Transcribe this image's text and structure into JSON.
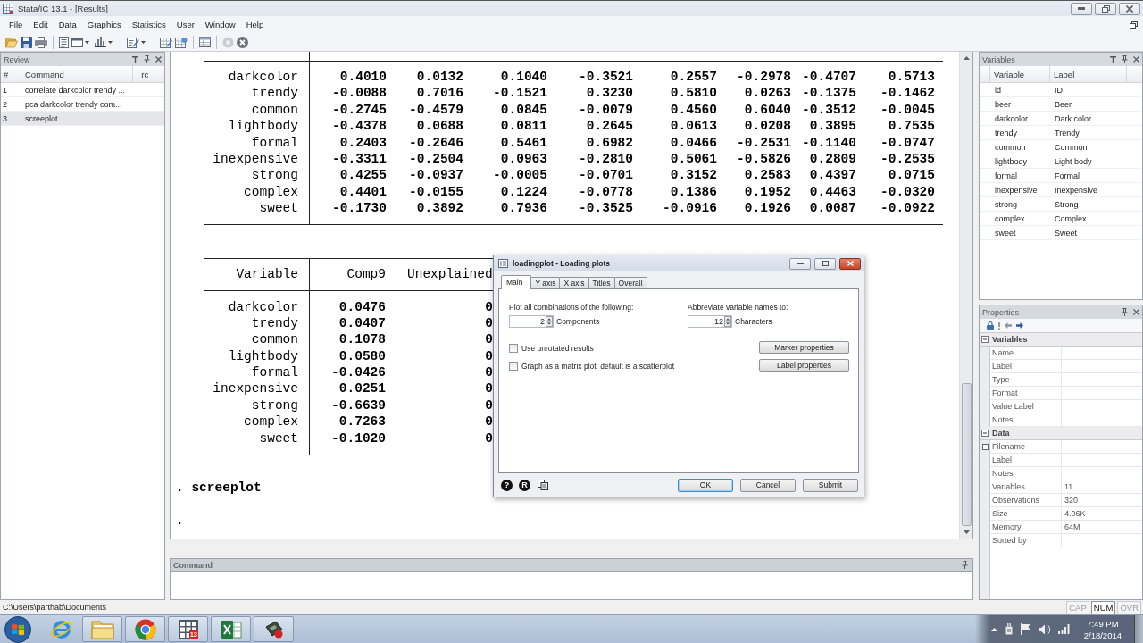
{
  "window": {
    "title": "Stata/IC 13.1 - [Results]"
  },
  "menu": [
    "File",
    "Edit",
    "Data",
    "Graphics",
    "Statistics",
    "User",
    "Window",
    "Help"
  ],
  "review": {
    "title": "Review",
    "columns": [
      "#",
      "Command",
      "_rc"
    ],
    "rows": [
      {
        "number": "1",
        "command": "correlate darkcolor trendy ...",
        "selected": false
      },
      {
        "number": "2",
        "command": "pca darkcolor trendy com...",
        "selected": false
      },
      {
        "number": "3",
        "command": "screeplot",
        "selected": true
      }
    ]
  },
  "results": {
    "loadings_table": {
      "rows": [
        {
          "variable": "darkcolor",
          "values": [
            "0.4010",
            "0.0132",
            "0.1040",
            "-0.3521",
            "0.2557",
            "-0.2978",
            "-0.4707",
            "0.5713"
          ]
        },
        {
          "variable": "trendy",
          "values": [
            "-0.0088",
            "0.7016",
            "-0.1521",
            "0.3230",
            "0.5810",
            "0.0263",
            "-0.1375",
            "-0.1462"
          ]
        },
        {
          "variable": "common",
          "values": [
            "-0.2745",
            "-0.4579",
            "0.0845",
            "-0.0079",
            "0.4560",
            "0.6040",
            "-0.3512",
            "-0.0045"
          ]
        },
        {
          "variable": "lightbody",
          "values": [
            "-0.4378",
            "0.0688",
            "0.0811",
            "0.2645",
            "0.0613",
            "0.0208",
            "0.3895",
            "0.7535"
          ]
        },
        {
          "variable": "formal",
          "values": [
            "0.2403",
            "-0.2646",
            "0.5461",
            "0.6982",
            "0.0466",
            "-0.2531",
            "-0.1140",
            "-0.0747"
          ]
        },
        {
          "variable": "inexpensive",
          "values": [
            "-0.3311",
            "-0.2504",
            "0.0963",
            "-0.2810",
            "0.5061",
            "-0.5826",
            "0.2809",
            "-0.2535"
          ]
        },
        {
          "variable": "strong",
          "values": [
            "0.4255",
            "-0.0937",
            "-0.0005",
            "-0.0701",
            "0.3152",
            "0.2583",
            "0.4397",
            "0.0715"
          ]
        },
        {
          "variable": "complex",
          "values": [
            "0.4401",
            "-0.0155",
            "0.1224",
            "-0.0778",
            "0.1386",
            "0.1952",
            "0.4463",
            "-0.0320"
          ]
        },
        {
          "variable": "sweet",
          "values": [
            "-0.1730",
            "0.3892",
            "0.7936",
            "-0.3525",
            "-0.0916",
            "0.1926",
            "0.0087",
            "-0.0922"
          ]
        }
      ]
    },
    "unexplained_table": {
      "columns": [
        "Variable",
        "Comp9",
        "Unexplained"
      ],
      "rows": [
        {
          "variable": "darkcolor",
          "comp9": "0.0476",
          "unexplained": "0"
        },
        {
          "variable": "trendy",
          "comp9": "0.0407",
          "unexplained": "0"
        },
        {
          "variable": "common",
          "comp9": "0.1078",
          "unexplained": "0"
        },
        {
          "variable": "lightbody",
          "comp9": "0.0580",
          "unexplained": "0"
        },
        {
          "variable": "formal",
          "comp9": "-0.0426",
          "unexplained": "0"
        },
        {
          "variable": "inexpensive",
          "comp9": "0.0251",
          "unexplained": "0"
        },
        {
          "variable": "strong",
          "comp9": "-0.6639",
          "unexplained": "0"
        },
        {
          "variable": "complex",
          "comp9": "0.7263",
          "unexplained": "0"
        },
        {
          "variable": "sweet",
          "comp9": "-0.1020",
          "unexplained": "0"
        }
      ]
    },
    "log": [
      {
        "prompt": ".",
        "command": "screeplot"
      },
      {
        "prompt": "."
      }
    ]
  },
  "command_panel": {
    "title": "Command"
  },
  "variables_panel": {
    "title": "Variables",
    "columns": [
      "Variable",
      "Label"
    ],
    "rows": [
      {
        "name": "id",
        "label": "ID",
        "selected": false
      },
      {
        "name": "beer",
        "label": "Beer",
        "selected": false
      },
      {
        "name": "darkcolor",
        "label": "Dark color",
        "selected": false
      },
      {
        "name": "trendy",
        "label": "Trendy",
        "selected": false
      },
      {
        "name": "common",
        "label": "Common",
        "selected": false
      },
      {
        "name": "lightbody",
        "label": "Light body",
        "selected": false
      },
      {
        "name": "formal",
        "label": "Formal",
        "selected": false
      },
      {
        "name": "inexpensive",
        "label": "Inexpensive",
        "selected": false
      },
      {
        "name": "strong",
        "label": "Strong",
        "selected": false
      },
      {
        "name": "complex",
        "label": "Complex",
        "selected": false
      },
      {
        "name": "sweet",
        "label": "Sweet",
        "selected": false
      }
    ]
  },
  "properties_panel": {
    "title": "Properties",
    "sections": [
      {
        "title": "Variables",
        "expanded": true,
        "rows": [
          {
            "name": "Name",
            "kind": "field"
          },
          {
            "name": "Label",
            "kind": "field"
          },
          {
            "name": "Type",
            "kind": "field"
          },
          {
            "name": "Format",
            "kind": "field"
          },
          {
            "name": "Value Label",
            "kind": "field"
          },
          {
            "name": "Notes",
            "kind": "field"
          }
        ]
      },
      {
        "title": "Data",
        "expanded": true,
        "rows": [
          {
            "name": "Filename",
            "kind": "group"
          },
          {
            "name": "Label",
            "kind": "field"
          },
          {
            "name": "Notes",
            "kind": "field"
          },
          {
            "name": "Variables",
            "value": "11",
            "kind": "field"
          },
          {
            "name": "Observations",
            "value": "320",
            "kind": "field"
          },
          {
            "name": "Size",
            "value": "4.06K",
            "kind": "field"
          },
          {
            "name": "Memory",
            "value": "64M",
            "kind": "field"
          },
          {
            "name": "Sorted by",
            "kind": "field"
          }
        ]
      }
    ]
  },
  "dialog": {
    "title": "loadingplot - Loading plots",
    "tabs": [
      {
        "label": "Main",
        "selected": true
      },
      {
        "label": "Y axis",
        "selected": false
      },
      {
        "label": "X axis",
        "selected": false
      },
      {
        "label": "Titles",
        "selected": false
      },
      {
        "label": "Overall",
        "selected": false
      }
    ],
    "spinners": [
      {
        "label": "Plot all combinations of the following:",
        "value": "2",
        "unit": "Components"
      },
      {
        "label": "Abbreviate variable names to:",
        "value": "12",
        "unit": "Characters"
      }
    ],
    "checkboxes": [
      {
        "label": "Use unrotated results",
        "checked": false
      },
      {
        "label": "Graph as a matrix plot; default is a scatterplot",
        "checked": false
      }
    ],
    "side_buttons": [
      "Marker properties",
      "Label properties"
    ],
    "help_button": "?",
    "reset_button": "R",
    "buttons": [
      {
        "label": "OK",
        "default": true
      },
      {
        "label": "Cancel",
        "default": false
      },
      {
        "label": "Submit",
        "default": false
      }
    ]
  },
  "status_bar": {
    "path": "C:\\Users\\parthab\\Documents",
    "indicators": [
      {
        "label": "CAP",
        "on": false
      },
      {
        "label": "NUM",
        "on": true
      },
      {
        "label": "OVR",
        "on": false
      }
    ]
  },
  "taskbar": {
    "app_badge": "13",
    "time": "7:49 PM",
    "date": "2/18/2014"
  }
}
